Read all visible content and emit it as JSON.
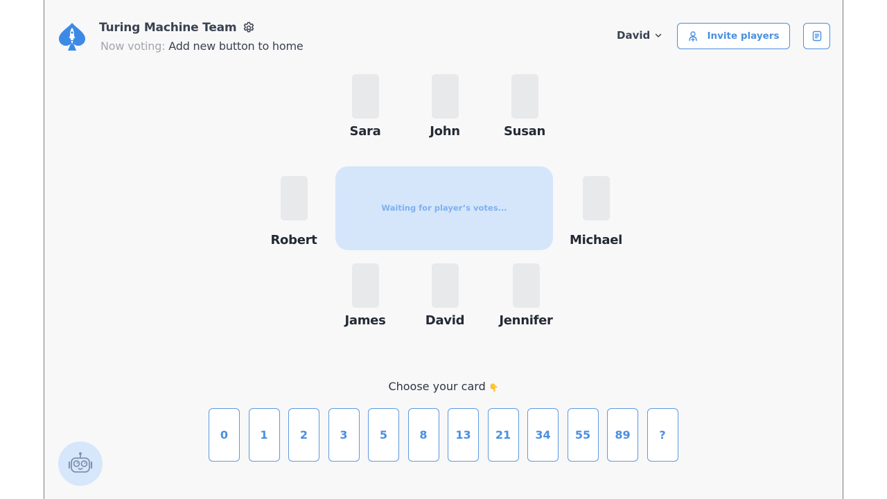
{
  "header": {
    "team_name": "Turing Machine Team",
    "voting_label": "Now voting:",
    "voting_story": "Add new button to home",
    "user_name": "David",
    "invite_label": "Invite players",
    "icons": {
      "logo": "spade-rocket-logo",
      "settings": "gear-icon",
      "user_menu": "chevron-down-icon",
      "invite": "user-plus-icon",
      "notes": "document-icon"
    }
  },
  "table": {
    "message": "Waiting for player’s votes...",
    "players_top": [
      {
        "name": "Sara"
      },
      {
        "name": "John"
      },
      {
        "name": "Susan"
      }
    ],
    "players_left": [
      {
        "name": "Robert"
      }
    ],
    "players_right": [
      {
        "name": "Michael"
      }
    ],
    "players_bottom": [
      {
        "name": "James"
      },
      {
        "name": "David"
      },
      {
        "name": "Jennifer"
      }
    ]
  },
  "deck": {
    "prompt": "Choose your card",
    "prompt_emoji": "👇",
    "cards": [
      "0",
      "1",
      "2",
      "3",
      "5",
      "8",
      "13",
      "21",
      "34",
      "55",
      "89",
      "?"
    ]
  },
  "assistant": {
    "icon": "robot-icon"
  },
  "colors": {
    "accent": "#4a8fe0",
    "table_bg": "#d5e6fb",
    "table_text": "#7eb0ee",
    "seat_card": "#e8e9eb",
    "page_bg": "#f8f8f9"
  }
}
